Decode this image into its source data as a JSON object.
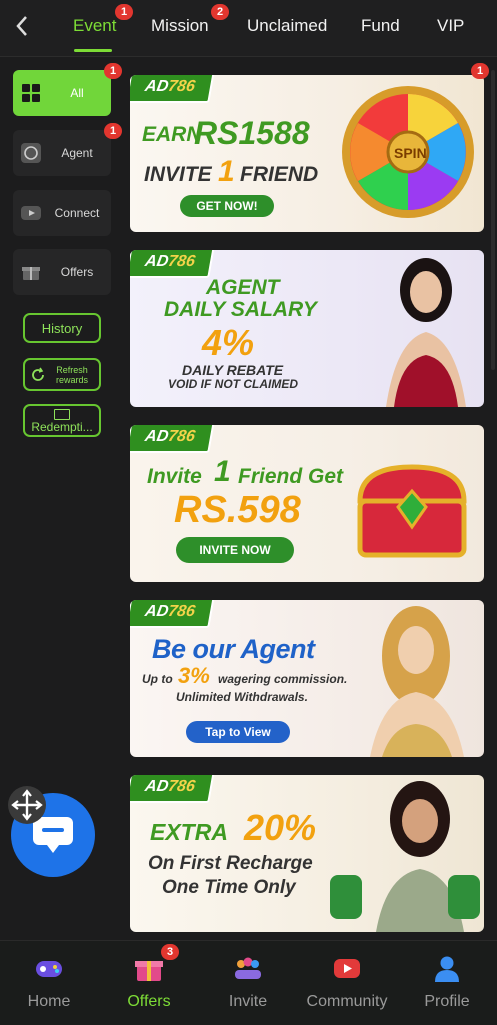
{
  "header": {
    "back_icon": "chevron-left-icon",
    "tabs": [
      {
        "label": "Event",
        "badge": "1",
        "active": true
      },
      {
        "label": "Mission",
        "badge": "2"
      },
      {
        "label": "Unclaimed"
      },
      {
        "label": "Fund"
      },
      {
        "label": "VIP"
      }
    ]
  },
  "sidebar": {
    "items": [
      {
        "label": "All",
        "badge": "1",
        "icon": "grid-icon",
        "active": true
      },
      {
        "label": "Agent",
        "badge": "1",
        "icon": "whatsapp-icon"
      },
      {
        "label": "Connect",
        "icon": "youtube-icon"
      },
      {
        "label": "Offers",
        "icon": "gift-icon"
      }
    ],
    "history": "History",
    "refresh": "Refresh rewards",
    "redemption": "Redempti..."
  },
  "banner_badge": "1",
  "banners": [
    {
      "brand_a": "AD",
      "brand_b": "786",
      "line1": "EARN",
      "line1b": "RS1588",
      "line2": "INVITE",
      "line2b": "1",
      "line2c": "FRIEND",
      "button": "GET NOW!",
      "spin": "SPIN"
    },
    {
      "brand_a": "AD",
      "brand_b": "786",
      "line1": "AGENT",
      "line2": "DAILY SALARY",
      "percent": "4%",
      "line3": "DAILY REBATE",
      "line4": "VOID IF NOT CLAIMED"
    },
    {
      "brand_a": "AD",
      "brand_b": "786",
      "line1": "Invite",
      "line1b": "1",
      "line1c": "Friend Get",
      "amount": "RS.598",
      "button": "INVITE NOW"
    },
    {
      "brand_a": "AD",
      "brand_b": "786",
      "line1": "Be our Agent",
      "line2a": "Up to",
      "line2b": "3%",
      "line2c": "wagering commission.",
      "line3": "Unlimited Withdrawals.",
      "button": "Tap to View"
    },
    {
      "brand_a": "AD",
      "brand_b": "786",
      "line1a": "EXTRA",
      "line1b": "20%",
      "line2": "On First Recharge",
      "line3": "One Time Only"
    }
  ],
  "bottom_nav": [
    {
      "label": "Home",
      "icon": "gamepad-icon"
    },
    {
      "label": "Offers",
      "icon": "gift-icon",
      "badge": "3",
      "active": true
    },
    {
      "label": "Invite",
      "icon": "people-icon"
    },
    {
      "label": "Community",
      "icon": "youtube-icon"
    },
    {
      "label": "Profile",
      "icon": "person-icon"
    }
  ],
  "colors": {
    "accent": "#7ddc36",
    "badge": "#e2362f",
    "chat": "#1e73e8"
  }
}
